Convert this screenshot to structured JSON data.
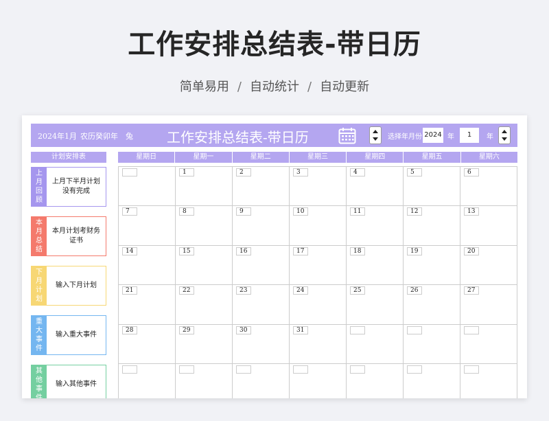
{
  "hero": {
    "title": "工作安排总结表-带日历",
    "sub": [
      "简单易用",
      "自动统计",
      "自动更新"
    ],
    "sep": "/"
  },
  "banner": {
    "date": "2024年1月",
    "lunar": "农历癸卯年",
    "zodiac": "兔",
    "title": "工作安排总结表-带日历",
    "select_label": "选择年月份",
    "year": "2024",
    "year_unit": "年",
    "month": "1",
    "month_unit": "年"
  },
  "left": {
    "head": "计划安排表",
    "cards": [
      {
        "tag": "上月回顾",
        "text": "上月下半月计划没有完成",
        "color": "#a596ee"
      },
      {
        "tag": "本月总结",
        "text": "本月计划考财务证书",
        "color": "#f47a6c"
      },
      {
        "tag": "下月计划",
        "text": "输入下月计划",
        "color": "#f7d774"
      },
      {
        "tag": "重大事件",
        "text": "输入重大事件",
        "color": "#74b6f0"
      },
      {
        "tag": "其他事件",
        "text": "输入其他事件",
        "color": "#74cfa0"
      }
    ]
  },
  "weekdays": [
    "星期日",
    "星期一",
    "星期二",
    "星期三",
    "星期四",
    "星期五",
    "星期六"
  ],
  "days": [
    "",
    "1",
    "2",
    "3",
    "4",
    "5",
    "6",
    "7",
    "8",
    "9",
    "10",
    "11",
    "12",
    "13",
    "14",
    "15",
    "16",
    "17",
    "18",
    "19",
    "20",
    "21",
    "22",
    "23",
    "24",
    "25",
    "26",
    "27",
    "28",
    "29",
    "30",
    "31",
    "",
    "",
    "",
    "",
    "",
    "",
    "",
    "",
    "",
    ""
  ],
  "colors": {
    "accent": "#b4a6f0"
  }
}
